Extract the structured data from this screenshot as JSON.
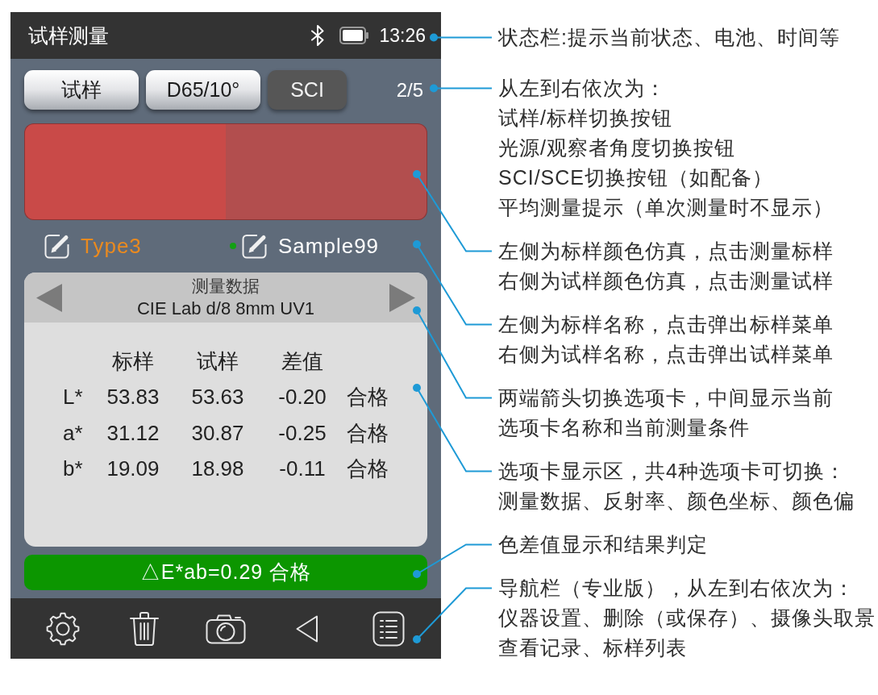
{
  "status_bar": {
    "title": "试样测量",
    "time": "13:26"
  },
  "toolbar": {
    "buttons": [
      {
        "label": "试样",
        "disabled": false
      },
      {
        "label": "D65/10°",
        "disabled": false
      },
      {
        "label": "SCI",
        "disabled": true
      }
    ],
    "average_count": "2/5"
  },
  "color_swatches": [
    {
      "color": "#c94a48"
    },
    {
      "color": "#b24e4e"
    }
  ],
  "names": [
    {
      "label": "Type3",
      "kind": "standard",
      "active": false
    },
    {
      "label": "Sample99",
      "kind": "sample",
      "active": true
    }
  ],
  "data_panel": {
    "title": "测量数据",
    "condition": "CIE Lab d/8 8mm UV1",
    "columns": [
      "标样",
      "试样",
      "差值"
    ],
    "rows": [
      {
        "label": "L*",
        "values": [
          "53.83",
          "53.63",
          "-0.20"
        ],
        "verdict": "合格"
      },
      {
        "label": "a*",
        "values": [
          "31.12",
          "30.87",
          "-0.25"
        ],
        "verdict": "合格"
      },
      {
        "label": "b*",
        "values": [
          "19.09",
          "18.98",
          "-0.11"
        ],
        "verdict": "合格"
      }
    ]
  },
  "result": {
    "text": "△E*ab=0.29 合格",
    "passed": true
  },
  "annotations": [
    {
      "lines": [
        "状态栏:提示当前状态、电池、时间等"
      ]
    },
    {
      "lines": [
        "从左到右依次为：",
        "试样/标样切换按钮",
        "光源/观察者角度切换按钮",
        "SCI/SCE切换按钮（如配备）",
        "平均测量提示（单次测量时不显示）"
      ]
    },
    {
      "lines": [
        "左侧为标样颜色仿真，点击测量标样",
        "右侧为试样颜色仿真，点击测量试样"
      ]
    },
    {
      "lines": [
        "左侧为标样名称，点击弹出标样菜单",
        "右侧为试样名称，点击弹出试样菜单"
      ]
    },
    {
      "lines": [
        "两端箭头切换选项卡，中间显示当前",
        "选项卡名称和当前测量条件"
      ]
    },
    {
      "lines": [
        "选项卡显示区，共4种选项卡可切换：",
        "测量数据、反射率、颜色坐标、颜色偏"
      ]
    },
    {
      "lines": [
        "色差值显示和结果判定"
      ]
    },
    {
      "lines": [
        "导航栏（专业版），从左到右依次为：",
        "仪器设置、删除（或保存）、摄像头取景",
        "查看记录、标样列表"
      ]
    }
  ]
}
